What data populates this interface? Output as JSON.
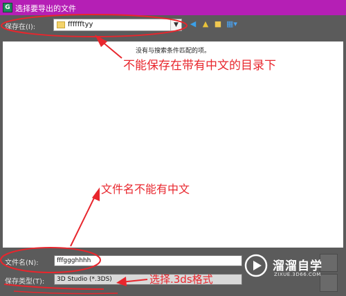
{
  "window": {
    "title": "选择要导出的文件",
    "app_icon": "app-icon"
  },
  "save_in": {
    "label": "保存在(I):",
    "folder": "fffffftyy",
    "icons": [
      "back-icon",
      "up-folder-icon",
      "new-folder-icon",
      "view-menu-icon"
    ]
  },
  "file_list": {
    "empty_message": "没有与搜索条件匹配的项。"
  },
  "file_name": {
    "label": "文件名(N):",
    "value": "fffggghhhh"
  },
  "save_type": {
    "label": "保存类型(T):",
    "value": "3D Studio (*.3DS)"
  },
  "annotations": {
    "chinese_dir_warning": "不能保存在带有中文的目录下",
    "filename_warning": "文件名不能有中文",
    "format_hint": "选择.3ds格式",
    "color": "#e8262d"
  },
  "watermark": {
    "name": "溜溜自学",
    "url": "ZIXUE.3D66.COM"
  }
}
